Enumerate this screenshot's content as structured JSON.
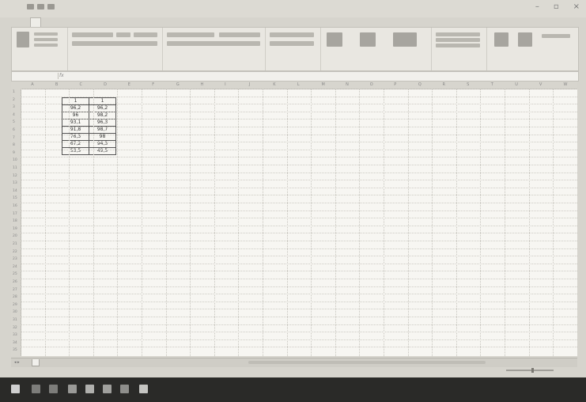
{
  "window": {
    "title": "",
    "controls": [
      "–",
      "▫",
      "×"
    ]
  },
  "ribbon_tabs": [
    "",
    "",
    "",
    "",
    "",
    "",
    ""
  ],
  "formula_bar": {
    "name_box": "",
    "formula": ""
  },
  "columns": [
    "A",
    "B",
    "C",
    "D",
    "E",
    "F",
    "G",
    "H",
    "I",
    "J",
    "K",
    "L",
    "M",
    "N",
    "O",
    "P",
    "Q",
    "R",
    "S",
    "T",
    "U",
    "V",
    "W"
  ],
  "table": [
    [
      "1",
      "1"
    ],
    [
      "96,2",
      "96,2"
    ],
    [
      "96",
      "98,2"
    ],
    [
      "93,1",
      "96,3"
    ],
    [
      "91,8",
      "98,7"
    ],
    [
      "76,3",
      "98"
    ],
    [
      "67,2",
      "94,3"
    ],
    [
      "53,5",
      "49,5"
    ]
  ],
  "sheet_tabs": [
    "",
    "",
    ""
  ],
  "colors": {
    "taskbar": "#2a2a28",
    "sheet_bg": "#f7f6f2"
  },
  "taskbar_icons": [
    "windows-start-icon",
    "search-icon",
    "task-view-icon",
    "edge-icon",
    "file-explorer-icon",
    "store-icon",
    "mail-icon",
    "excel-icon"
  ]
}
